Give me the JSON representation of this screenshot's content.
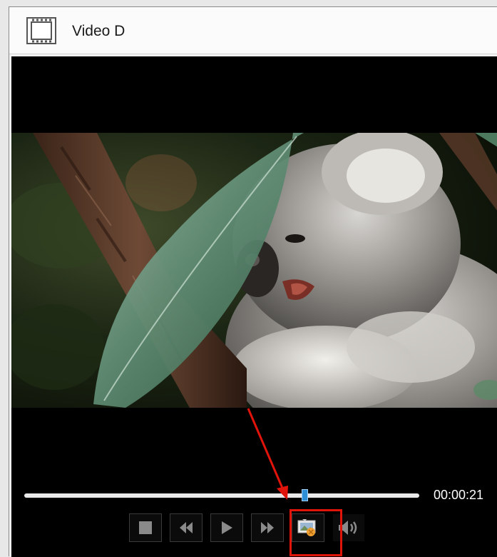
{
  "window": {
    "title": "Video D",
    "icon": "film-icon"
  },
  "player": {
    "video_subject": "koala",
    "seek_position_fraction": 0.71,
    "time": "00:00:21",
    "controls": [
      {
        "name": "stop-button",
        "icon": "stop-icon"
      },
      {
        "name": "rewind-button",
        "icon": "rewind-icon"
      },
      {
        "name": "play-button",
        "icon": "play-icon"
      },
      {
        "name": "fast-forward-button",
        "icon": "fast-forward-icon"
      },
      {
        "name": "snapshot-button",
        "icon": "snapshot-icon",
        "highlighted": true
      },
      {
        "name": "volume-button",
        "icon": "speaker-icon"
      }
    ]
  },
  "annotation": {
    "highlight_color": "#e0140b",
    "target": "snapshot-button"
  }
}
